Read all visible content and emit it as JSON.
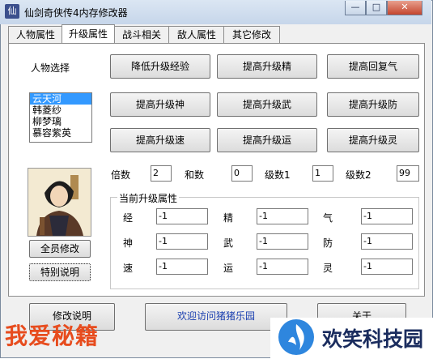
{
  "window": {
    "title": "仙剑奇侠传4内存修改器",
    "icon_glyph": "仙",
    "controls": {
      "minimize": "—",
      "maximize": "□",
      "close": "✕"
    }
  },
  "tabs": [
    "人物属性",
    "升级属性",
    "战斗相关",
    "敌人属性",
    "其它修改"
  ],
  "active_tab_index": 1,
  "character_select": {
    "label": "人物选择",
    "items": [
      "云天河",
      "韩菱纱",
      "柳梦璃",
      "慕容紫英"
    ],
    "selected_index": 0
  },
  "upgrade_buttons": [
    "降低升级经验",
    "提高升级精",
    "提高回复气",
    "提高升级神",
    "提高升级武",
    "提高升级防",
    "提高升级速",
    "提高升级运",
    "提高升级灵"
  ],
  "params": {
    "multiplier_label": "倍数",
    "multiplier_value": "2",
    "sum_label": "和数",
    "sum_value": "0",
    "level1_label": "级数1",
    "level1_value": "1",
    "level2_label": "级数2",
    "level2_value": "99"
  },
  "current_attrs": {
    "title": "当前升级属性",
    "items": [
      {
        "label": "经",
        "value": "-1"
      },
      {
        "label": "精",
        "value": "-1"
      },
      {
        "label": "气",
        "value": "-1"
      },
      {
        "label": "神",
        "value": "-1"
      },
      {
        "label": "武",
        "value": "-1"
      },
      {
        "label": "防",
        "value": "-1"
      },
      {
        "label": "速",
        "value": "-1"
      },
      {
        "label": "运",
        "value": "-1"
      },
      {
        "label": "灵",
        "value": "-1"
      }
    ]
  },
  "side_buttons": {
    "modify_all": "全员修改",
    "special_note": "特别说明"
  },
  "bottom_buttons": {
    "modify_note": "修改说明",
    "welcome": "欢迎访问猪猪乐园",
    "close": "关于"
  },
  "watermarks": {
    "left": "我爱秘籍",
    "right": "欢笑科技园"
  },
  "colors": {
    "selection": "#3399ff",
    "watermark_left": "#e74c1e",
    "watermark_right": "#1a2c5e"
  }
}
